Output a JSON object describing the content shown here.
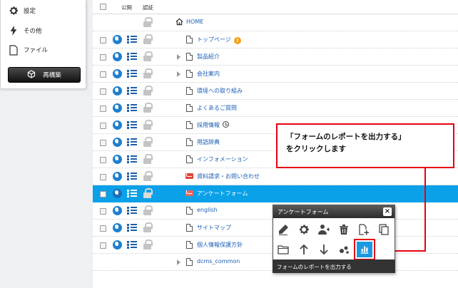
{
  "sidebar": {
    "items": [
      {
        "label": "設定",
        "icon": "gear-icon"
      },
      {
        "label": "その他",
        "icon": "lightning-icon"
      },
      {
        "label": "ファイル",
        "icon": "file-icon"
      }
    ],
    "rebuild_label": "再構築"
  },
  "table": {
    "col_public": "公開",
    "col_auth": "認証"
  },
  "tree": {
    "home": "HOME",
    "rows": [
      {
        "label": "トップページ"
      },
      {
        "label": "製品紹介"
      },
      {
        "label": "会社案内"
      },
      {
        "label": "環境への取り組み"
      },
      {
        "label": "よくあるご質問"
      },
      {
        "label": "採用情報"
      },
      {
        "label": "用語辞典"
      },
      {
        "label": "インフォメーション"
      },
      {
        "label": "資料請求・お問い合わせ"
      },
      {
        "label": "アンケートフォーム"
      },
      {
        "label": "english"
      },
      {
        "label": "サイトマップ"
      },
      {
        "label": "個人情報保護方針"
      },
      {
        "label": "dcms_common"
      }
    ]
  },
  "callout": {
    "line1": "「フォームのレポートを出力する」",
    "line2": "をクリックします"
  },
  "popup": {
    "title": "アンケートフォーム",
    "close": "×",
    "footer": "フォームのレポートを出力する"
  },
  "colors": {
    "selected_row": "#0aa1e8",
    "link": "#1b5fb5",
    "accent_red": "#e60012"
  }
}
